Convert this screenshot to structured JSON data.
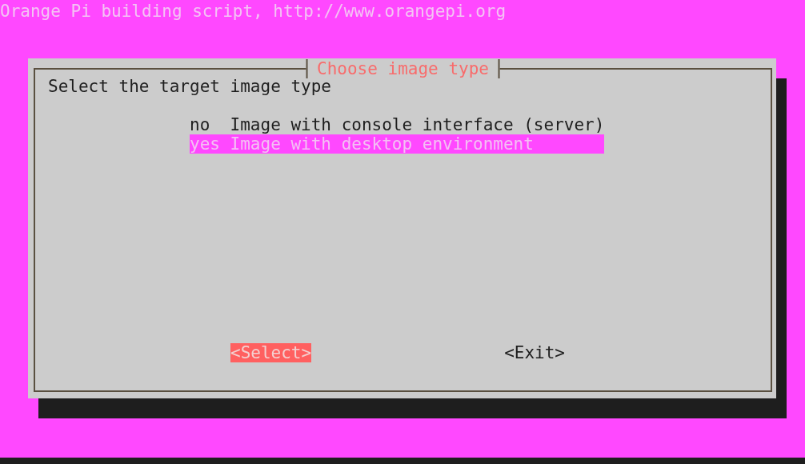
{
  "header": "Orange Pi building script, http://www.orangepi.org",
  "dialog": {
    "title": "Choose image type",
    "prompt": "Select the target image type",
    "items": [
      {
        "tag": "no",
        "label": "Image with console interface (server)",
        "selected": false
      },
      {
        "tag": "yes",
        "label": "Image with desktop environment",
        "selected": true
      }
    ],
    "buttons": [
      {
        "label": "<Select>",
        "selected": true
      },
      {
        "label": "<Exit>",
        "selected": false
      }
    ]
  }
}
